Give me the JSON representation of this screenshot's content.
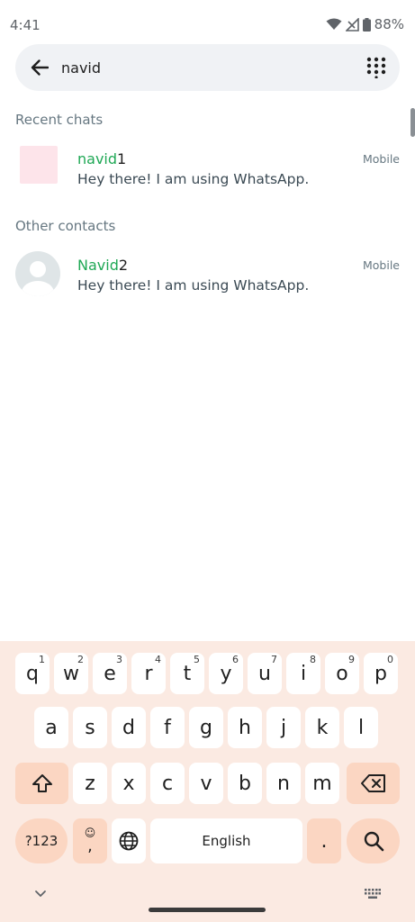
{
  "status_bar": {
    "time": "4:41",
    "battery": "88%"
  },
  "search": {
    "query": "navid"
  },
  "sections": {
    "recent": "Recent chats",
    "other": "Other contacts"
  },
  "recent_chats": [
    {
      "name_match": "navid",
      "name_rest": "1",
      "status": "Hey there! I am using WhatsApp.",
      "type": "Mobile"
    }
  ],
  "other_contacts": [
    {
      "name_match": "Navid",
      "name_rest": "2",
      "status": "Hey there! I am using WhatsApp.",
      "type": "Mobile"
    }
  ],
  "keyboard": {
    "row1": [
      {
        "k": "q",
        "h": "1"
      },
      {
        "k": "w",
        "h": "2"
      },
      {
        "k": "e",
        "h": "3"
      },
      {
        "k": "r",
        "h": "4"
      },
      {
        "k": "t",
        "h": "5"
      },
      {
        "k": "y",
        "h": "6"
      },
      {
        "k": "u",
        "h": "7"
      },
      {
        "k": "i",
        "h": "8"
      },
      {
        "k": "o",
        "h": "9"
      },
      {
        "k": "p",
        "h": "0"
      }
    ],
    "row2": [
      "a",
      "s",
      "d",
      "f",
      "g",
      "h",
      "j",
      "k",
      "l"
    ],
    "row3": [
      "z",
      "x",
      "c",
      "v",
      "b",
      "n",
      "m"
    ],
    "symbols_label": "?123",
    "comma_label": ",",
    "space_label": "English",
    "period_label": "."
  },
  "colors": {
    "highlight": "#1fa855",
    "keyboard_bg": "#fbeae2",
    "modifier_key": "#fbd6c2"
  },
  "icons": [
    "back-arrow-icon",
    "dialpad-icon",
    "wifi-icon",
    "signal-icon",
    "battery-icon",
    "shift-icon",
    "backspace-icon",
    "emoji-icon",
    "globe-icon",
    "search-icon",
    "chevron-down-icon",
    "keyboard-icon"
  ]
}
